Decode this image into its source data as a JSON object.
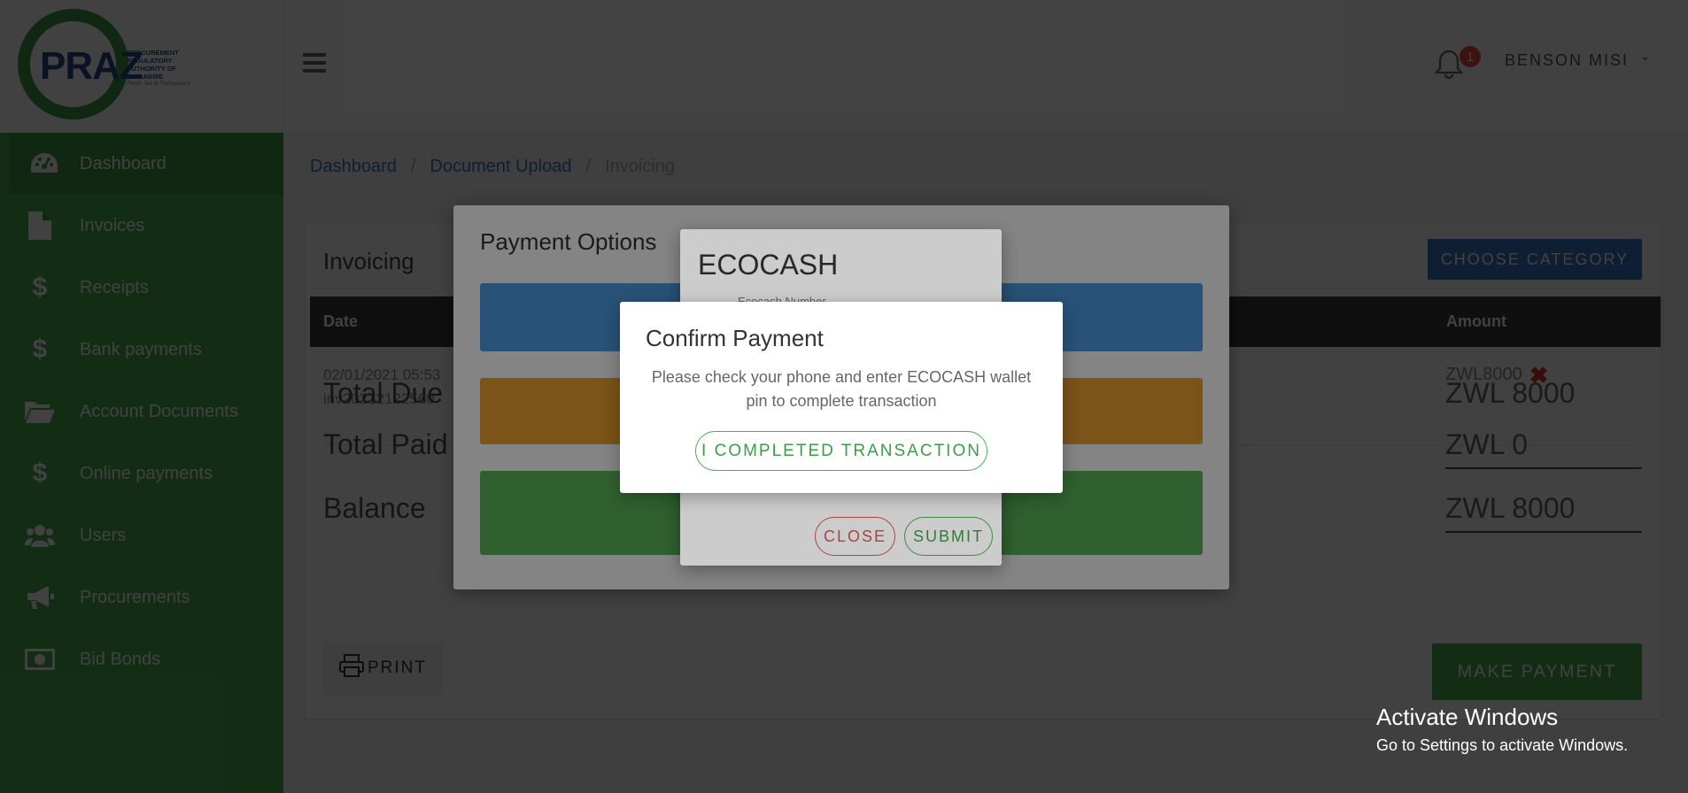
{
  "brand": {
    "logo_text": "PRAZ",
    "logo_subtitle": "PROCUREMENT REGULATORY AUTHORITY OF ZIMBABWE",
    "logo_tagline": "Fresh, fair & Transparent"
  },
  "header": {
    "notification_count": "1",
    "user_name": "BENSON MISI"
  },
  "sidebar": {
    "items": [
      {
        "label": "Dashboard",
        "icon": "dashboard-icon"
      },
      {
        "label": "Invoices",
        "icon": "file-icon"
      },
      {
        "label": "Receipts",
        "icon": "dollar-icon"
      },
      {
        "label": "Bank payments",
        "icon": "dollar-icon"
      },
      {
        "label": "Account Documents",
        "icon": "folder-open-icon"
      },
      {
        "label": "Online payments",
        "icon": "dollar-icon"
      },
      {
        "label": "Users",
        "icon": "users-icon"
      },
      {
        "label": "Procurements",
        "icon": "megaphone-icon"
      },
      {
        "label": "Bid Bonds",
        "icon": "money-bill-icon"
      }
    ]
  },
  "breadcrumb": {
    "items": [
      "Dashboard",
      "Document Upload",
      "Invoicing"
    ],
    "separator": "/"
  },
  "card": {
    "title": "Invoicing",
    "choose_category": "CHOOSE CATEGORY",
    "table": {
      "columns": [
        "Date",
        "Amount"
      ],
      "rows": [
        {
          "date": "02/01/2021 05:53",
          "invoice": "inv20212122560",
          "amount": "ZWL8000"
        }
      ]
    },
    "totals": {
      "total_due_label": "Total Due",
      "total_due_value": "ZWL 8000",
      "total_paid_label": "Total Paid",
      "total_paid_value": "ZWL 0",
      "balance_label": "Balance",
      "balance_value": "ZWL 8000"
    },
    "print_label": "PRINT",
    "make_payment_label": "MAKE PAYMENT"
  },
  "payment_options_modal": {
    "title": "Payment Options"
  },
  "ecocash_modal": {
    "title": "ECOCASH",
    "field_label": "Ecocash Number",
    "close_label": "CLOSE",
    "submit_label": "SUBMIT"
  },
  "confirm_modal": {
    "title": "Confirm Payment",
    "message": "Please check your phone and enter ECOCASH wallet pin to complete transaction",
    "button_label": "I COMPLETED TRANSACTION"
  },
  "watermark": {
    "title": "Activate Windows",
    "subtitle": "Go to Settings to activate Windows."
  },
  "colors": {
    "sidebar_green": "#4ab054",
    "primary_blue": "#3b78c9",
    "danger_red": "#d9534f",
    "orange": "#f0a030"
  }
}
